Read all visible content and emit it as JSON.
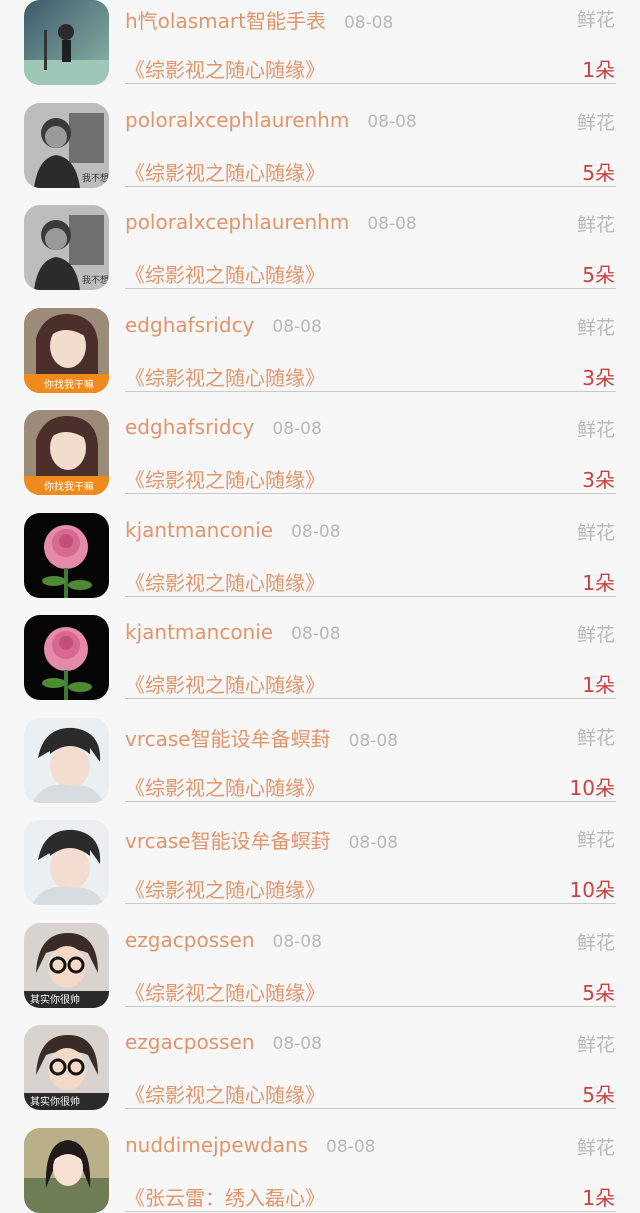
{
  "gift_records": [
    {
      "name": "h忾olasmart智能手表",
      "date": "08-08",
      "gift": "鲜花",
      "work": "《综影视之随心随缘》",
      "count": "1朵",
      "avatar": "girl-dark-scene-icon"
    },
    {
      "name": "poloralxcephlaurenhm",
      "date": "08-08",
      "gift": "鲜花",
      "work": "《综影视之随心随缘》",
      "count": "5朵",
      "avatar": "girl-bw-photo-icon"
    },
    {
      "name": "poloralxcephlaurenhm",
      "date": "08-08",
      "gift": "鲜花",
      "work": "《综影视之随心随缘》",
      "count": "5朵",
      "avatar": "girl-bw-photo-icon"
    },
    {
      "name": "edghafsridcy",
      "date": "08-08",
      "gift": "鲜花",
      "work": "《综影视之随心随缘》",
      "count": "3朵",
      "avatar": "girl-long-hair-icon"
    },
    {
      "name": "edghafsridcy",
      "date": "08-08",
      "gift": "鲜花",
      "work": "《综影视之随心随缘》",
      "count": "3朵",
      "avatar": "girl-long-hair-icon"
    },
    {
      "name": "kjantmanconie",
      "date": "08-08",
      "gift": "鲜花",
      "work": "《综影视之随心随缘》",
      "count": "1朵",
      "avatar": "pink-rose-icon"
    },
    {
      "name": "kjantmanconie",
      "date": "08-08",
      "gift": "鲜花",
      "work": "《综影视之随心随缘》",
      "count": "1朵",
      "avatar": "pink-rose-icon"
    },
    {
      "name": "vrcase智能设牟备螟葑",
      "date": "08-08",
      "gift": "鲜花",
      "work": "《综影视之随心随缘》",
      "count": "10朵",
      "avatar": "boy-selfie-icon"
    },
    {
      "name": "vrcase智能设牟备螟葑",
      "date": "08-08",
      "gift": "鲜花",
      "work": "《综影视之随心随缘》",
      "count": "10朵",
      "avatar": "boy-selfie-icon"
    },
    {
      "name": "ezgacpossen",
      "date": "08-08",
      "gift": "鲜花",
      "work": "《综影视之随心随缘》",
      "count": "5朵",
      "avatar": "glasses-avatar-icon"
    },
    {
      "name": "ezgacpossen",
      "date": "08-08",
      "gift": "鲜花",
      "work": "《综影视之随心随缘》",
      "count": "5朵",
      "avatar": "glasses-avatar-icon"
    },
    {
      "name": "nuddimejpewdans",
      "date": "08-08",
      "gift": "鲜花",
      "work": "《张云雷：绣入磊心》",
      "count": "1朵",
      "avatar": "anime-girl-icon"
    }
  ]
}
